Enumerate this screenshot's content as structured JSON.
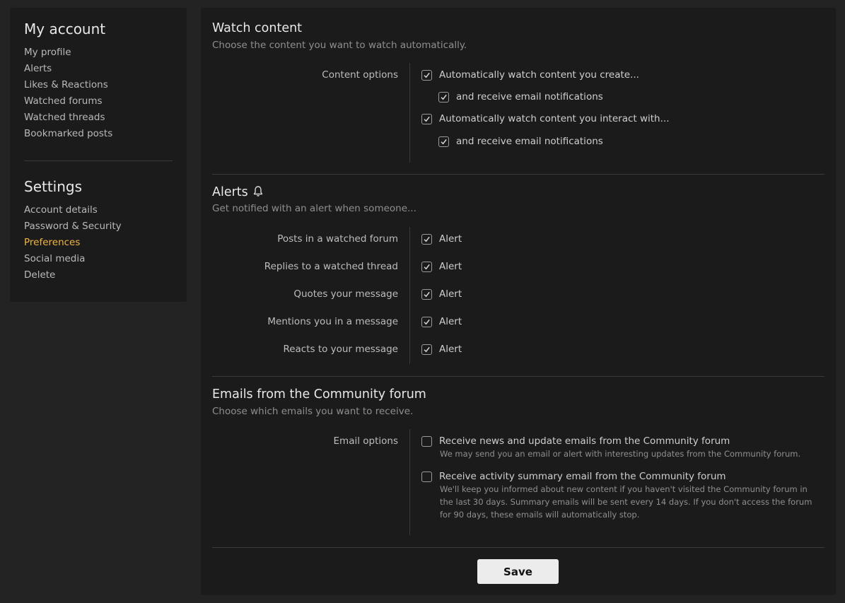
{
  "sidebar": {
    "account_title": "My account",
    "account_links": [
      "My profile",
      "Alerts",
      "Likes & Reactions",
      "Watched forums",
      "Watched threads",
      "Bookmarked posts"
    ],
    "settings_title": "Settings",
    "settings_links": [
      "Account details",
      "Password & Security",
      "Preferences",
      "Social media",
      "Delete"
    ],
    "active": "Preferences",
    "active_color": "#f2b544"
  },
  "watch": {
    "title": "Watch content",
    "desc": "Choose the content you want to watch automatically.",
    "label": "Content options",
    "opt1": "Automatically watch content you create...",
    "opt1_sub": "and receive email notifications",
    "opt2": "Automatically watch content you interact with...",
    "opt2_sub": "and receive email notifications"
  },
  "alerts": {
    "title": "Alerts",
    "icon": "bell-icon",
    "desc": "Get notified with an alert when someone...",
    "check_label": "Alert",
    "rows": [
      "Posts in a watched forum",
      "Replies to a watched thread",
      "Quotes your message",
      "Mentions you in a message",
      "Reacts to your message"
    ]
  },
  "emails": {
    "title": "Emails from the Community forum",
    "desc": "Choose which emails you want to receive.",
    "label": "Email options",
    "opt1": "Receive news and update emails from the Community forum",
    "opt1_hint": "We may send you an email or alert with interesting updates from the Community forum.",
    "opt2": "Receive activity summary email from the Community forum",
    "opt2_hint": "We'll keep you informed about new content if you haven't visited the Community forum in the last 30 days. Summary emails will be sent every 14 days. If you don't access the forum for 90 days, these emails will automatically stop."
  },
  "save_label": "Save"
}
